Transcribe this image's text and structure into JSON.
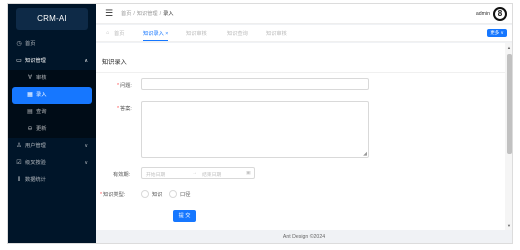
{
  "sidebar": {
    "logo": "CRM-AI",
    "items": [
      {
        "label": "首页",
        "icon": "◷"
      },
      {
        "label": "知识管理",
        "icon": "▭",
        "arrow": "∧"
      },
      {
        "label": "审核",
        "icon": "∀"
      },
      {
        "label": "录入",
        "icon": "▦"
      },
      {
        "label": "查询",
        "icon": "▤"
      },
      {
        "label": "更新",
        "icon": "⊖"
      },
      {
        "label": "用户管理",
        "icon": "♙",
        "arrow": "∨"
      },
      {
        "label": "级叉按验",
        "icon": "☑",
        "arrow": "∨"
      },
      {
        "label": "数据统计",
        "icon": "⫴"
      }
    ]
  },
  "header": {
    "fold_icon": "☰",
    "breadcrumb": [
      "首页",
      "知识管理",
      "录入"
    ],
    "separator": "/",
    "username": "admin",
    "avatar_letter": "8"
  },
  "tabs": {
    "home_icon": "⌂",
    "items": [
      {
        "label": "首页"
      },
      {
        "label": "知识录入 ×"
      },
      {
        "label": "知识审核"
      },
      {
        "label": "知识查询"
      },
      {
        "label": "知识审核"
      }
    ],
    "more_label": "更多 ∨"
  },
  "form": {
    "card_title": "知识录入",
    "question_label": "问题:",
    "answer_label": "答案:",
    "required_mark": "*",
    "validity_label": "有效期:",
    "start_placeholder": "开始日期",
    "range_arrow": "→",
    "end_placeholder": "结束日期",
    "calendar_icon": "▣",
    "type_label": "知识类型:",
    "type_options": [
      "知识",
      "口径"
    ],
    "submit_label": "提 交",
    "resize_glyph": "◢"
  },
  "footer": {
    "text": "Ant Design ©2024"
  },
  "colors": {
    "primary": "#1677ff",
    "sidebar_bg": "#001529",
    "required": "#ff4d4f"
  }
}
